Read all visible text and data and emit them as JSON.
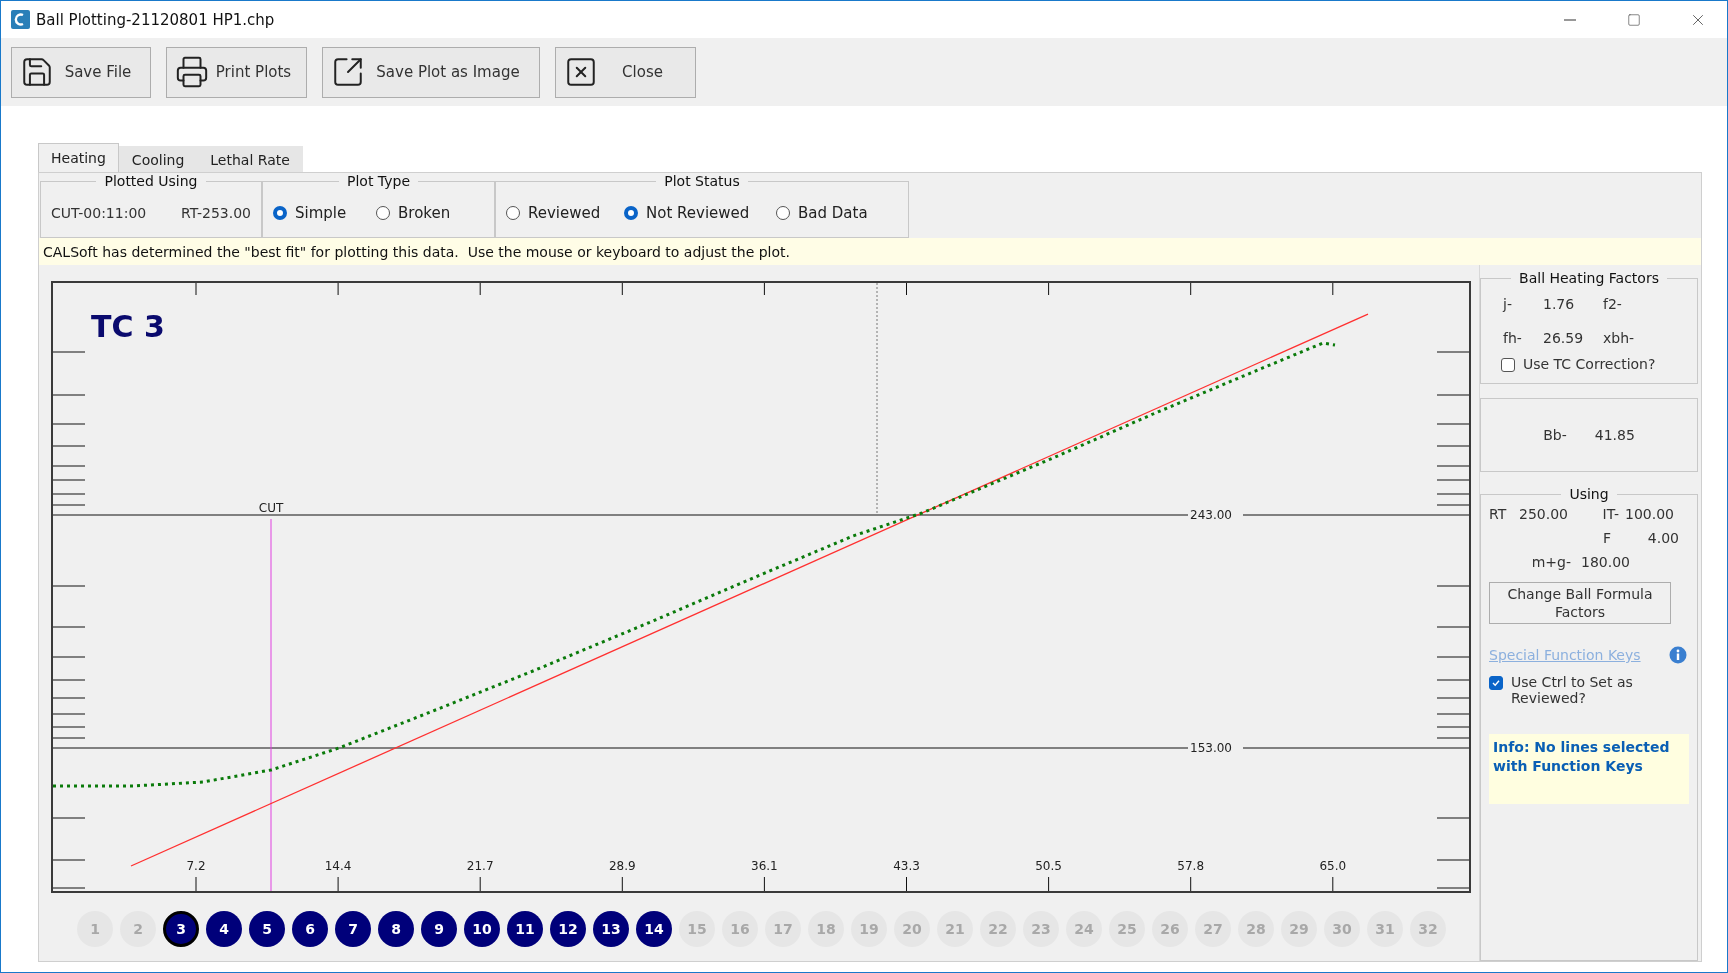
{
  "window": {
    "title": "Ball Plotting-21120801 HP1.chp"
  },
  "toolbar": [
    {
      "kind": "save",
      "label": "Save File"
    },
    {
      "kind": "print",
      "label": "Print Plots"
    },
    {
      "kind": "image",
      "label": "Save Plot as Image"
    },
    {
      "kind": "close",
      "label": "Close"
    }
  ],
  "tabs": [
    {
      "label": "Heating",
      "selected": true
    },
    {
      "label": "Cooling",
      "selected": false
    },
    {
      "label": "Lethal Rate",
      "selected": false
    }
  ],
  "plotted_using": {
    "title": "Plotted Using",
    "cut": "CUT-00:11:00",
    "rt": "RT-253.00"
  },
  "plot_type": {
    "title": "Plot Type",
    "options": [
      {
        "label": "Simple",
        "selected": true
      },
      {
        "label": "Broken",
        "selected": false
      }
    ]
  },
  "plot_status": {
    "title": "Plot Status",
    "options": [
      {
        "label": "Reviewed",
        "selected": false
      },
      {
        "label": "Not Reviewed",
        "selected": true
      },
      {
        "label": "Bad Data",
        "selected": false
      }
    ]
  },
  "message": "CALSoft has determined the \"best fit\" for plotting this data.  Use the mouse or keyboard to adjust the plot.",
  "plot": {
    "title": "TC 3",
    "cut_label": "CUT",
    "x_tick_labels": [
      "7.2",
      "14.4",
      "21.7",
      "28.9",
      "36.1",
      "43.3",
      "50.5",
      "57.8",
      "65.0"
    ],
    "reference_lines": [
      "243.00",
      "153.00"
    ]
  },
  "heating_factors": {
    "title": "Ball Heating Factors",
    "rows": [
      [
        "j-",
        "1.76",
        "f2-"
      ],
      [
        "fh-",
        "26.59",
        "xbh-"
      ]
    ],
    "tc_correction": {
      "label": "Use TC Correction?",
      "checked": false
    }
  },
  "bb": {
    "label": "Bb-",
    "value": "41.85"
  },
  "using": {
    "title": "Using",
    "rt_label": "RT",
    "rt": "250.00",
    "it_label": "IT-",
    "it": "100.00",
    "f_label": "F",
    "f": "4.00",
    "mg_label": "m+g-",
    "mg": "180.00",
    "button": "Change Ball Formula Factors",
    "link": "Special Function Keys",
    "ctrl_checkbox": {
      "label": "Use Ctrl to Set as Reviewed?",
      "checked": true
    },
    "info": "Info: No lines selected with Function Keys"
  },
  "tc_selector": [
    {
      "label": "1",
      "active": false,
      "selected": false
    },
    {
      "label": "2",
      "active": false,
      "selected": false
    },
    {
      "label": "3",
      "active": true,
      "selected": true
    },
    {
      "label": "4",
      "active": true,
      "selected": false
    },
    {
      "label": "5",
      "active": true,
      "selected": false
    },
    {
      "label": "6",
      "active": true,
      "selected": false
    },
    {
      "label": "7",
      "active": true,
      "selected": false
    },
    {
      "label": "8",
      "active": true,
      "selected": false
    },
    {
      "label": "9",
      "active": true,
      "selected": false
    },
    {
      "label": "10",
      "active": true,
      "selected": false
    },
    {
      "label": "11",
      "active": true,
      "selected": false
    },
    {
      "label": "12",
      "active": true,
      "selected": false
    },
    {
      "label": "13",
      "active": true,
      "selected": false
    },
    {
      "label": "14",
      "active": true,
      "selected": false
    },
    {
      "label": "15",
      "active": false,
      "selected": false
    },
    {
      "label": "16",
      "active": false,
      "selected": false
    },
    {
      "label": "17",
      "active": false,
      "selected": false
    },
    {
      "label": "18",
      "active": false,
      "selected": false
    },
    {
      "label": "19",
      "active": false,
      "selected": false
    },
    {
      "label": "20",
      "active": false,
      "selected": false
    },
    {
      "label": "21",
      "active": false,
      "selected": false
    },
    {
      "label": "22",
      "active": false,
      "selected": false
    },
    {
      "label": "23",
      "active": false,
      "selected": false
    },
    {
      "label": "24",
      "active": false,
      "selected": false
    },
    {
      "label": "25",
      "active": false,
      "selected": false
    },
    {
      "label": "26",
      "active": false,
      "selected": false
    },
    {
      "label": "27",
      "active": false,
      "selected": false
    },
    {
      "label": "28",
      "active": false,
      "selected": false
    },
    {
      "label": "29",
      "active": false,
      "selected": false
    },
    {
      "label": "30",
      "active": false,
      "selected": false
    },
    {
      "label": "31",
      "active": false,
      "selected": false
    },
    {
      "label": "32",
      "active": false,
      "selected": false
    }
  ]
}
